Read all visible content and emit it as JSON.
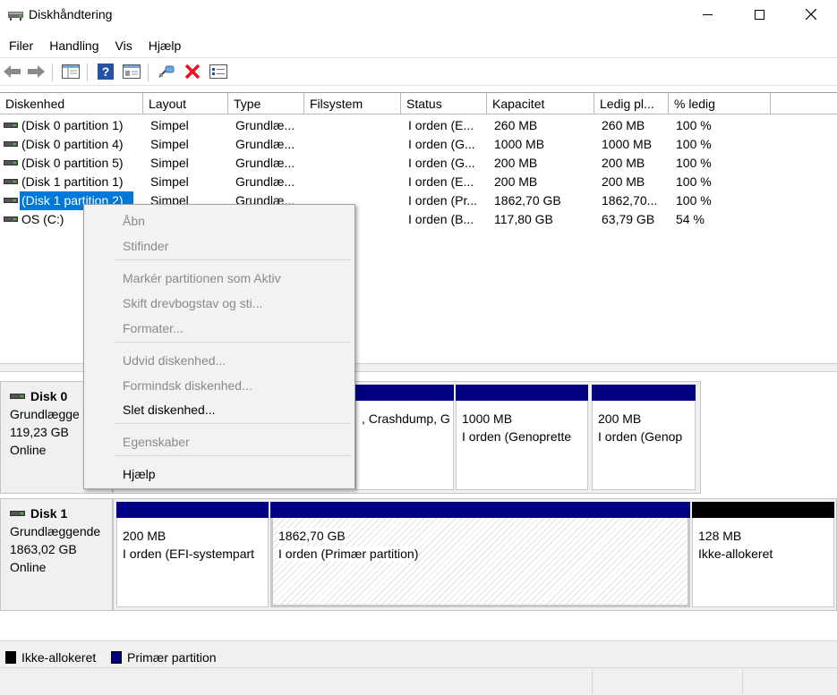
{
  "window": {
    "title": "Diskhåndtering",
    "icon": "disk-management-icon",
    "controls": {
      "minimize": "minimize-icon",
      "maximize": "maximize-icon",
      "close": "close-icon"
    }
  },
  "menu": [
    "Filer",
    "Handling",
    "Vis",
    "Hjælp"
  ],
  "toolbar": [
    "back-arrow-icon",
    "forward-arrow-icon",
    "console-tree-icon",
    "help-icon",
    "properties-icon",
    "connect-icon",
    "delete-icon",
    "checklist-icon"
  ],
  "columns": [
    "Diskenhed",
    "Layout",
    "Type",
    "Filsystem",
    "Status",
    "Kapacitet",
    "Ledig pl...",
    "% ledig"
  ],
  "volumes": [
    {
      "name": "(Disk 0 partition 1)",
      "layout": "Simpel",
      "type": "Grundlæ...",
      "fs": "",
      "status": "I orden (E...",
      "capacity": "260 MB",
      "free": "260 MB",
      "pct": "100 %"
    },
    {
      "name": "(Disk 0 partition 4)",
      "layout": "Simpel",
      "type": "Grundlæ...",
      "fs": "",
      "status": "I orden (G...",
      "capacity": "1000 MB",
      "free": "1000 MB",
      "pct": "100 %"
    },
    {
      "name": "(Disk 0 partition 5)",
      "layout": "Simpel",
      "type": "Grundlæ...",
      "fs": "",
      "status": "I orden (G...",
      "capacity": "200 MB",
      "free": "200 MB",
      "pct": "100 %"
    },
    {
      "name": "(Disk 1 partition 1)",
      "layout": "Simpel",
      "type": "Grundlæ...",
      "fs": "",
      "status": "I orden (E...",
      "capacity": "200 MB",
      "free": "200 MB",
      "pct": "100 %"
    },
    {
      "name": "(Disk 1 partition 2)",
      "layout": "Simpel",
      "type": "Grundlæ...",
      "fs": "",
      "status": "I orden (Pr...",
      "capacity": "1862,70 GB",
      "free": "1862,70...",
      "pct": "100 %"
    },
    {
      "name": "OS (C:)",
      "layout": "",
      "type": "",
      "fs": "",
      "status": "I orden (B...",
      "capacity": "117,80 GB",
      "free": "63,79 GB",
      "pct": "54 %"
    }
  ],
  "disks": [
    {
      "name": "Disk 0",
      "type": "Grundlægge",
      "size": "119,23 GB",
      "state": "Online",
      "partitions": [
        {
          "size": "",
          "status": ", Crashdump, G",
          "color": "#000080"
        },
        {
          "size": "1000 MB",
          "status": "I orden (Genoprette",
          "color": "#000080"
        },
        {
          "size": "200 MB",
          "status": "I orden (Genop",
          "color": "#000080"
        }
      ]
    },
    {
      "name": "Disk 1",
      "type": "Grundlæggende",
      "size": "1863,02 GB",
      "state": "Online",
      "partitions": [
        {
          "size": "200 MB",
          "status": "I orden (EFI-systempart",
          "color": "#000080"
        },
        {
          "size": "1862,70 GB",
          "status": "I orden (Primær partition)",
          "color": "#000080"
        },
        {
          "size": "128 MB",
          "status": "Ikke-allokeret",
          "color": "#000000"
        }
      ]
    }
  ],
  "legend": [
    {
      "label": "Ikke-allokeret",
      "color": "#000000"
    },
    {
      "label": "Primær partition",
      "color": "#000080"
    }
  ],
  "context_menu": [
    {
      "label": "Åbn",
      "enabled": false
    },
    {
      "label": "Stifinder",
      "enabled": false
    },
    {
      "label": "Markér partitionen som Aktiv",
      "enabled": false
    },
    {
      "label": "Skift drevbogstav og sti...",
      "enabled": false
    },
    {
      "label": "Formater...",
      "enabled": false
    },
    {
      "label": "Udvid diskenhed...",
      "enabled": false
    },
    {
      "label": "Formindsk diskenhed...",
      "enabled": false
    },
    {
      "label": "Slet diskenhed...",
      "enabled": true
    },
    {
      "label": "Egenskaber",
      "enabled": false
    },
    {
      "label": "Hjælp",
      "enabled": true
    }
  ],
  "colors": {
    "selection": "#0078d7",
    "primary": "#000080",
    "unallocated": "#000000",
    "delete": "#e81123"
  }
}
